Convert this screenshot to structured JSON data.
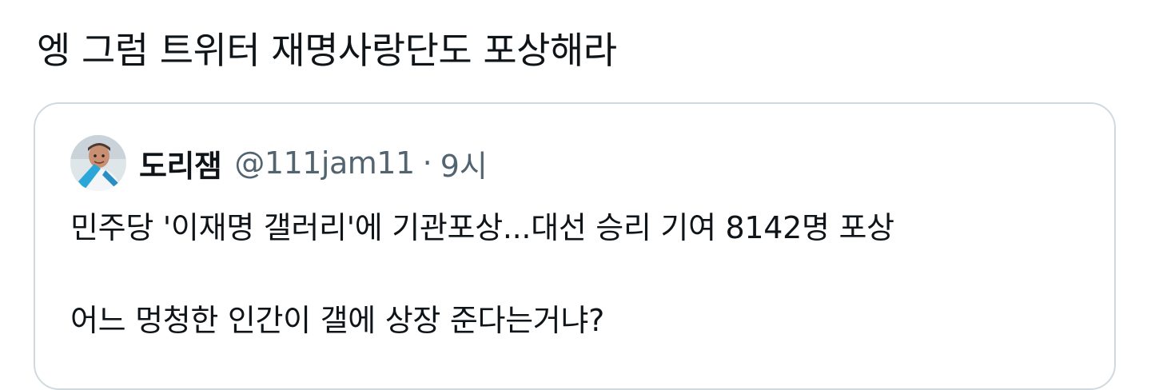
{
  "tweet": {
    "text": "엥 그럼 트위터 재명사랑단도 포상해라"
  },
  "quoted_tweet": {
    "avatar_icon": "avatar-photo",
    "display_name": "도리잼",
    "handle": "@111jam11",
    "separator": "·",
    "time": "9시",
    "line1": "민주당 '이재명 갤러리'에 기관포상...대선 승리 기여 8142명 포상",
    "line2": "어느 멍청한 인간이 갤에 상장 준다는거냐?"
  },
  "colors": {
    "text_primary": "#0f1419",
    "text_secondary": "#536471",
    "border": "#cfd9de"
  }
}
